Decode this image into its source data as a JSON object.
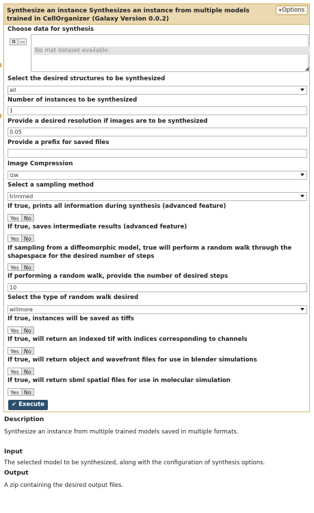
{
  "tool": {
    "title": "Synthesize an instance Synthesizes an instance from multiple models trained in CellOrganizer (Galaxy Version 0.0.2)",
    "options_label": "Options"
  },
  "form": {
    "data_label": "Choose data for synthesis",
    "data_placeholder": "No mat dataset available.",
    "structures_label": "Select the desired structures to be synthesized",
    "structures_value": "all",
    "instances_label": "Number of instances to be synthesized",
    "instances_value": "1",
    "resolution_label": "Provide a desired resolution if images are to be synthesized",
    "resolution_value": "0.05",
    "prefix_label": "Provide a prefix for saved files",
    "prefix_value": "",
    "compression_label": "Image Compression",
    "compression_value": "lzw",
    "sampling_label": "Select a sampling method",
    "sampling_value": "trimmed",
    "verbose_label": "If true, prints all information during synthesis (advanced feature)",
    "debug_label": "If true, saves intermediate results (advanced feature)",
    "walk_label": "If sampling from a diffeomorphic model, true will perform a random walk through the shapespace for the desired number of steps",
    "steps_label": "If performing a random walk, provide the number of desired steps",
    "steps_value": "10",
    "walk_type_label": "Select the type of random walk desired",
    "walk_type_value": "willmore",
    "tiff_label": "If true, instances will be saved as tiffs",
    "indexed_label": "If true, will return an indexed tif with indices corresponding to channels",
    "blender_label": "If true, will return object and wavefront files for use in blender simulations",
    "sbml_label": "If true, will return sbml spatial files for use in molecular simulation",
    "yes": "Yes",
    "no": "No",
    "execute_label": "Execute"
  },
  "help": {
    "description_heading": "Description",
    "description_text": "Synthesize an instance from multiple trained models saved in multiple formats.",
    "input_heading": "Input",
    "input_text": "The selected model to be synthesized, along with the configuration of synthesis options.",
    "output_heading": "Output",
    "output_text": "A zip containing the desired output files."
  },
  "icons": [
    "copy-icon",
    "folder-icon",
    "caret-down-icon",
    "check-icon",
    "resize-handle-icon"
  ],
  "colors": {
    "header_bg": "#ebd9b2",
    "border": "#d8b365",
    "execute_bg": "#2c4f6e"
  }
}
